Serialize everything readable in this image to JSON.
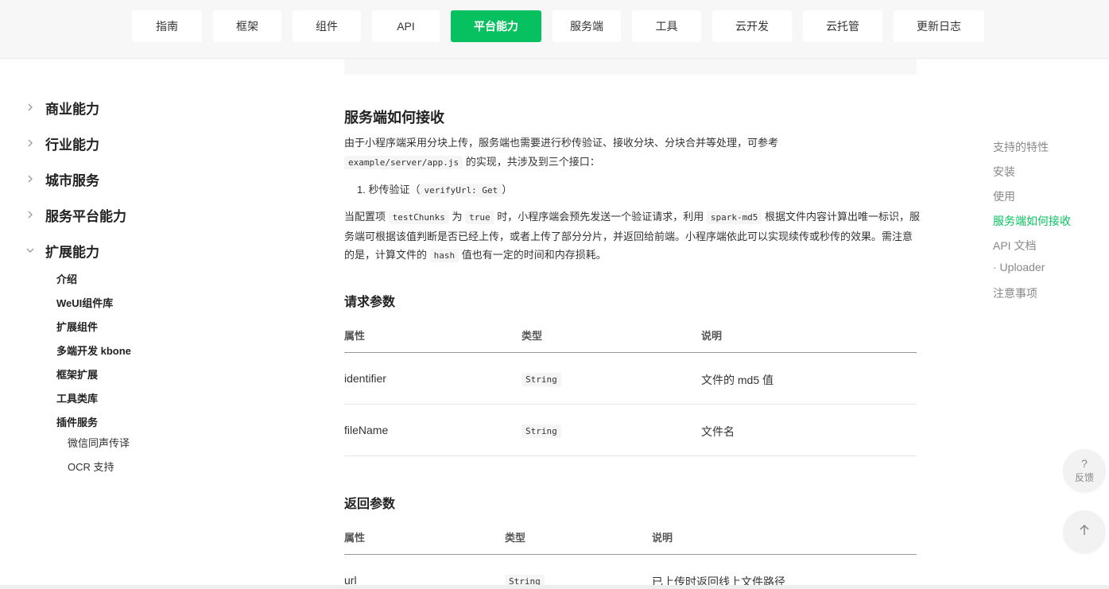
{
  "topnav": {
    "tabs": [
      {
        "label": "指南",
        "active": false
      },
      {
        "label": "框架",
        "active": false
      },
      {
        "label": "组件",
        "active": false
      },
      {
        "label": "API",
        "active": false
      },
      {
        "label": "平台能力",
        "active": true
      },
      {
        "label": "服务端",
        "active": false
      },
      {
        "label": "工具",
        "active": false
      },
      {
        "label": "云开发",
        "active": false
      },
      {
        "label": "云托管",
        "active": false
      },
      {
        "label": "更新日志",
        "active": false
      }
    ]
  },
  "sidebar": {
    "groups": [
      {
        "label": "商业能力",
        "expanded": false
      },
      {
        "label": "行业能力",
        "expanded": false
      },
      {
        "label": "城市服务",
        "expanded": false
      },
      {
        "label": "服务平台能力",
        "expanded": false
      },
      {
        "label": "扩展能力",
        "expanded": true
      }
    ],
    "subitems": [
      "介绍",
      "WeUI组件库",
      "扩展组件",
      "多端开发 kbone",
      "框架扩展",
      "工具类库",
      "插件服务"
    ],
    "subsubitems": [
      "微信同声传译",
      "OCR 支持"
    ]
  },
  "content": {
    "section_title": "服务端如何接收",
    "intro": {
      "p1_text_a": "由于小程序端采用分块上传，服务端也需要进行秒传验证、接收分块、分块合并等处理，可参考",
      "p1_code": "example/server/app.js",
      "p1_text_b": " 的实现，共涉及到三个接口："
    },
    "list": {
      "item1_text_a": "1. 秒传验证（",
      "item1_code": "verifyUrl: Get",
      "item1_text_b": "）"
    },
    "para2": {
      "t1": "当配置项 ",
      "c1": "testChunks",
      "t2": " 为 ",
      "c2": "true",
      "t3": " 时，小程序端会预先发送一个验证请求，利用 ",
      "c3": "spark-md5",
      "t4": " 根据文件内容计算出唯一标识，服务端可根据该值判断是否已经上传，或者上传了部分分片，并返回给前端。小程序端依此可以实现续传或秒传的效果。需注意的是，计算文件的 ",
      "c4": "hash",
      "t5": " 值也有一定的时间和内存损耗。"
    },
    "request_params": {
      "title": "请求参数",
      "headers": [
        "属性",
        "类型",
        "说明"
      ],
      "rows": [
        [
          "identifier",
          "String",
          "文件的 md5 值"
        ],
        [
          "fileName",
          "String",
          "文件名"
        ]
      ]
    },
    "response_params": {
      "title": "返回参数",
      "headers": [
        "属性",
        "类型",
        "说明"
      ],
      "rows": [
        [
          "url",
          "String",
          "已上传时返回线上文件路径"
        ]
      ]
    }
  },
  "toc": {
    "items": [
      {
        "label": "支持的特性",
        "active": false
      },
      {
        "label": "安装",
        "active": false
      },
      {
        "label": "使用",
        "active": false
      },
      {
        "label": "服务端如何接收",
        "active": true
      },
      {
        "label": "API 文档",
        "active": false
      },
      {
        "label": "· Uploader",
        "active": false
      },
      {
        "label": "注意事项",
        "active": false
      }
    ]
  },
  "floating": {
    "feedback_glyph": "?",
    "feedback_label": "反馈"
  },
  "colors": {
    "accent": "#07c160",
    "nav_bg": "#f7f7f7"
  }
}
